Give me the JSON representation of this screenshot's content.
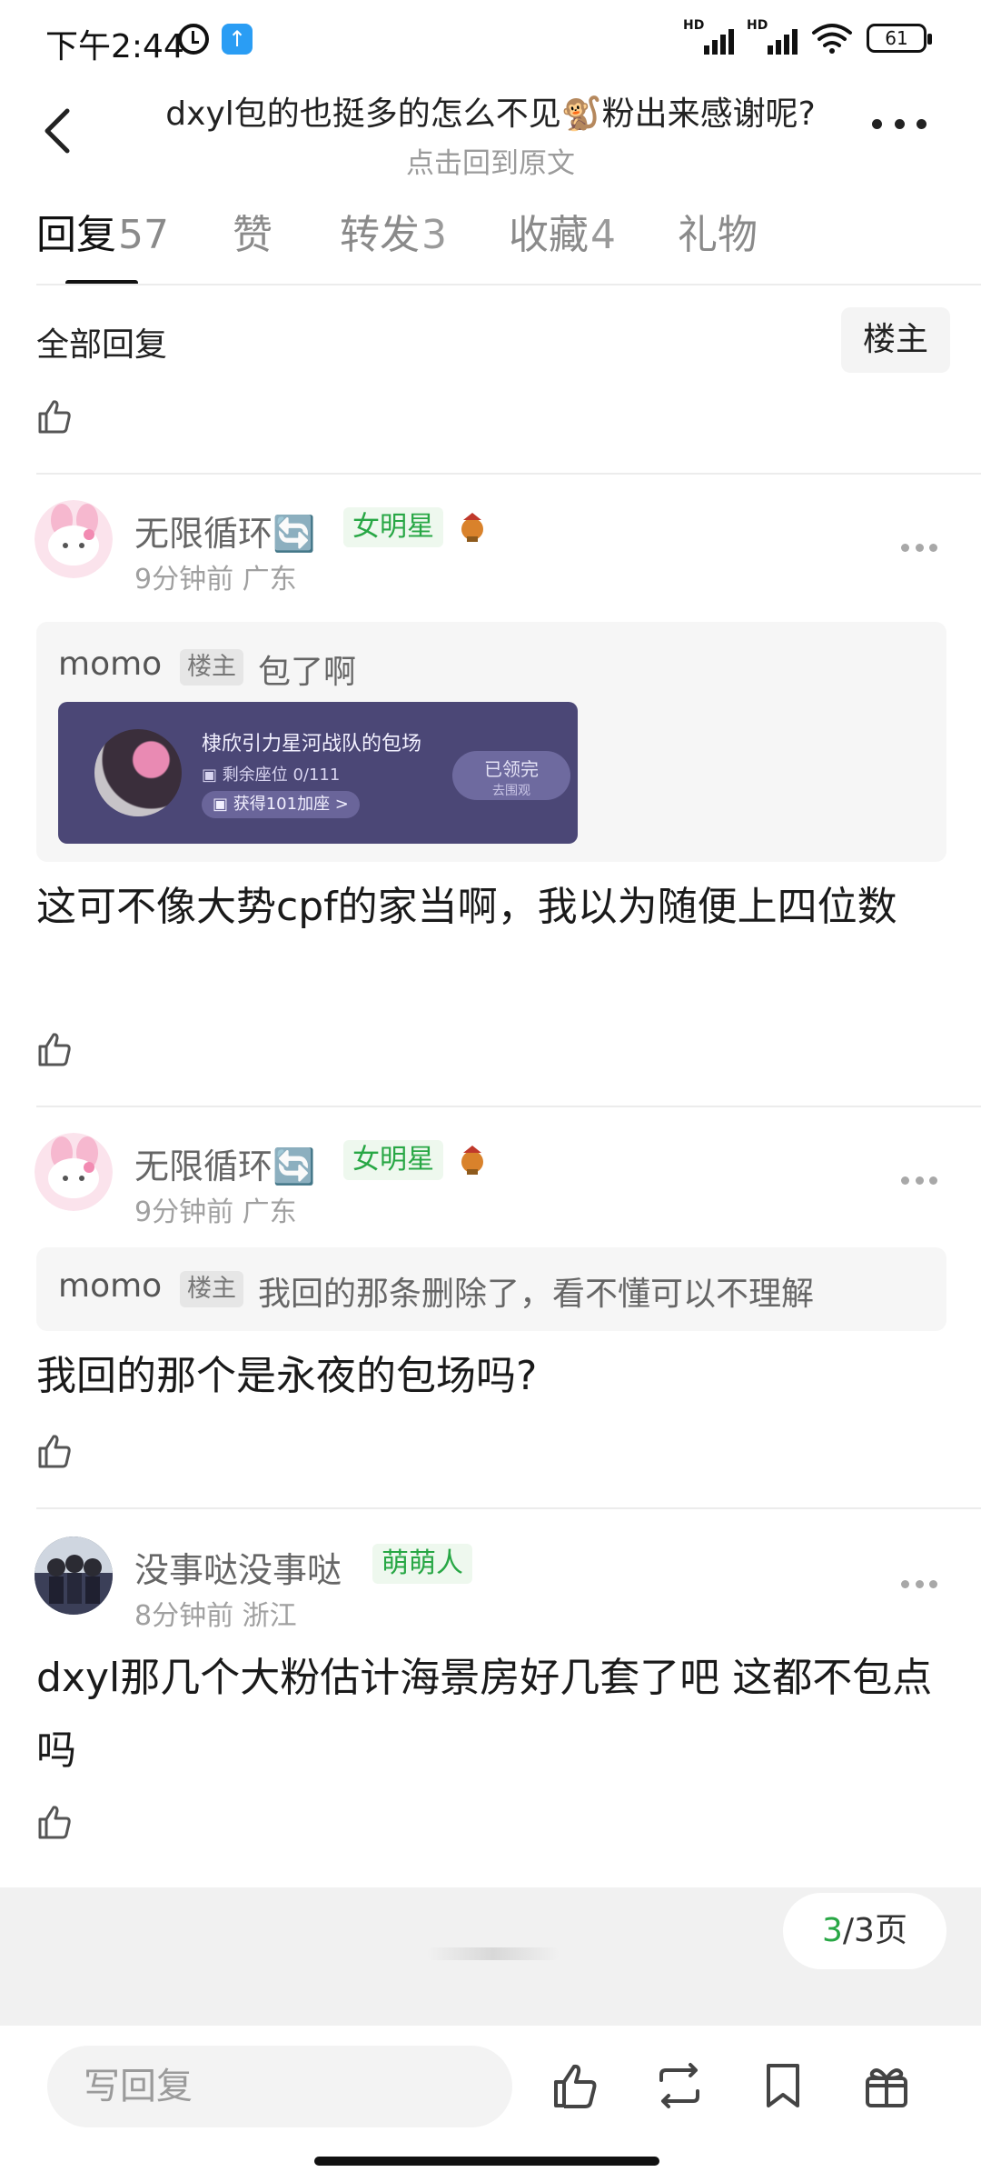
{
  "status_bar": {
    "time": "下午2:44",
    "battery": "61",
    "hd_label": "HD"
  },
  "header": {
    "title": "dxyl包的也挺多的怎么不见🐒粉出来感谢呢?",
    "subtitle": "点击回到原文"
  },
  "tabs": [
    {
      "label": "回复",
      "count": "57"
    },
    {
      "label": "赞",
      "count": ""
    },
    {
      "label": "转发",
      "count": "3"
    },
    {
      "label": "收藏",
      "count": "4"
    },
    {
      "label": "礼物",
      "count": ""
    }
  ],
  "filter": {
    "all_replies": "全部回复",
    "op_only": "楼主"
  },
  "comments": [
    {
      "user": "无限循环🔄",
      "badge": "女明星",
      "meta": "9分钟前 广东",
      "quote": {
        "name": "momo",
        "op_tag": "楼主",
        "text": "包了啊"
      },
      "card": {
        "title": "棣欣引力星河战队的包场",
        "seats": "剩余座位 0/111",
        "get": "获得101加座 >",
        "button": "已领完",
        "button_sub": "去围观"
      },
      "text": "这可不像大势cpf的家当啊，我以为随便上四位数"
    },
    {
      "user": "无限循环🔄",
      "badge": "女明星",
      "meta": "9分钟前 广东",
      "quote": {
        "name": "momo",
        "op_tag": "楼主",
        "text": "我回的那条删除了，看不懂可以不理解"
      },
      "text": "我回的那个是永夜的包场吗?"
    },
    {
      "user": "没事哒没事哒",
      "badge": "萌萌人",
      "meta": "8分钟前 浙江",
      "text": "dxyl那几个大粉估计海景房好几套了吧 这都不包点吗"
    }
  ],
  "pager": {
    "current": "3",
    "total": "/3页"
  },
  "bottom_bar": {
    "reply_placeholder": "写回复"
  },
  "colors": {
    "accent_green": "#28a745",
    "badge_bg": "#eef8ee",
    "card_bg": "#4b4776"
  }
}
